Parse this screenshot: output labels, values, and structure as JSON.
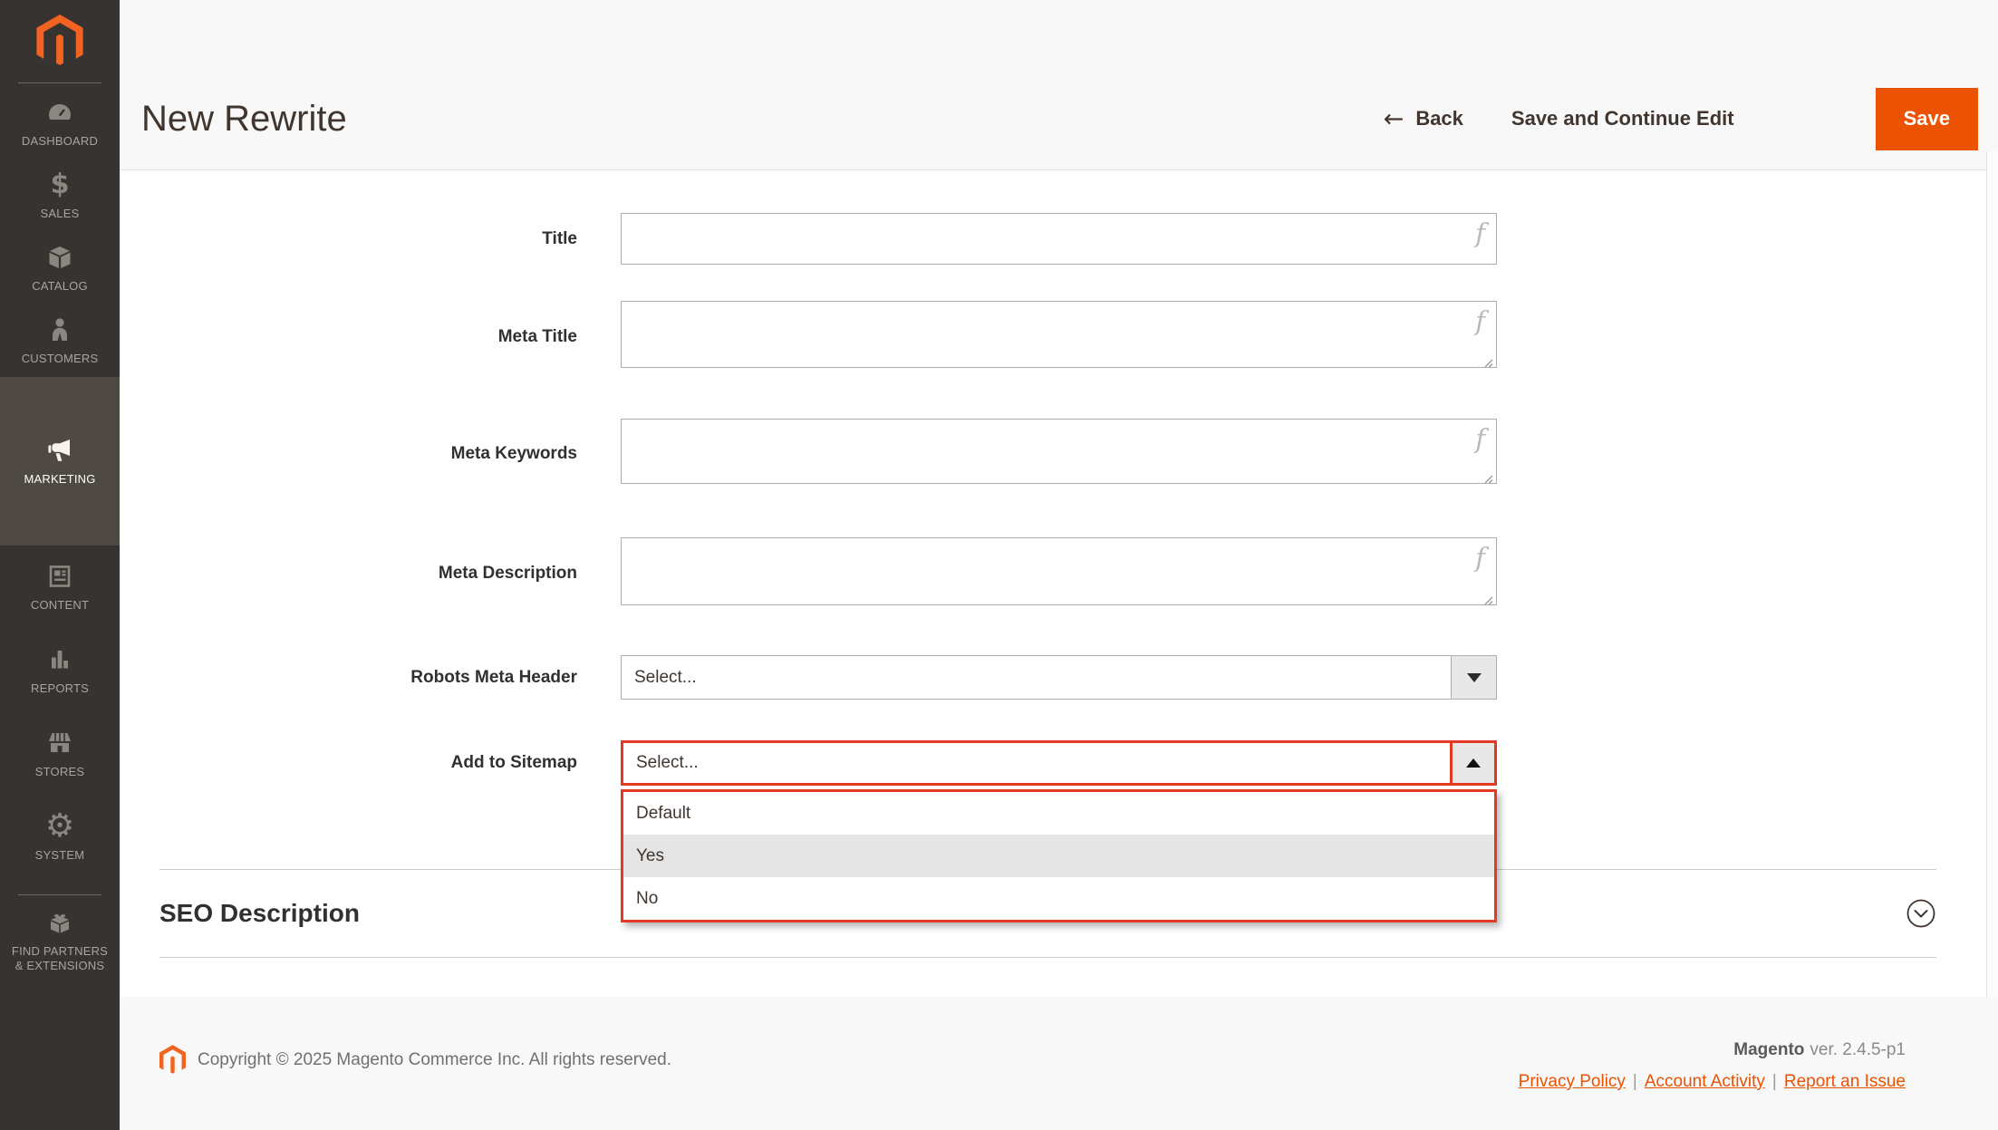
{
  "colors": {
    "accent": "#eb5202",
    "magento_orange": "#f26322",
    "highlight_border": "#e23b22",
    "sidebar_bg": "#373330",
    "sidebar_active_bg": "#4f4943"
  },
  "icons": {
    "formula": "f",
    "back_arrow": "←",
    "sales_dollar": "$",
    "system_gear": "⚙"
  },
  "sidebar": {
    "items": [
      {
        "label": "DASHBOARD",
        "icon": "dashboard-gauge-icon"
      },
      {
        "label": "SALES",
        "icon": "sales-dollar-icon"
      },
      {
        "label": "CATALOG",
        "icon": "catalog-box-icon"
      },
      {
        "label": "CUSTOMERS",
        "icon": "customers-person-icon"
      },
      {
        "label": "MARKETING",
        "icon": "marketing-megaphone-icon",
        "active": true
      },
      {
        "label": "CONTENT",
        "icon": "content-page-icon"
      },
      {
        "label": "REPORTS",
        "icon": "reports-chart-icon"
      },
      {
        "label": "STORES",
        "icon": "stores-shop-icon"
      },
      {
        "label": "SYSTEM",
        "icon": "system-gear-icon"
      },
      {
        "label": "FIND PARTNERS\n& EXTENSIONS",
        "icon": "extensions-brick-icon"
      }
    ]
  },
  "header": {
    "title": "New Rewrite",
    "back": "Back",
    "save_and_continue": "Save and Continue Edit",
    "save": "Save"
  },
  "form": {
    "rows": [
      {
        "label": "Title",
        "type": "text",
        "value": ""
      },
      {
        "label": "Meta Title",
        "type": "textarea",
        "value": ""
      },
      {
        "label": "Meta Keywords",
        "type": "textarea",
        "value": ""
      },
      {
        "label": "Meta Description",
        "type": "textarea",
        "value": ""
      },
      {
        "label": "Robots Meta Header",
        "type": "select",
        "value": "Select..."
      },
      {
        "label": "Add to Sitemap",
        "type": "select",
        "value": "Select...",
        "open": true
      }
    ],
    "sitemap_dropdown": {
      "options": [
        "Default",
        "Yes",
        "No"
      ],
      "highlighted": "Yes"
    }
  },
  "seo_section": {
    "title": "SEO Description"
  },
  "footer": {
    "copyright": "Copyright © 2025 Magento Commerce Inc. All rights reserved.",
    "brand": "Magento",
    "version": "ver. 2.4.5-p1",
    "separator": "|",
    "links": [
      "Privacy Policy",
      "Account Activity",
      "Report an Issue"
    ]
  }
}
